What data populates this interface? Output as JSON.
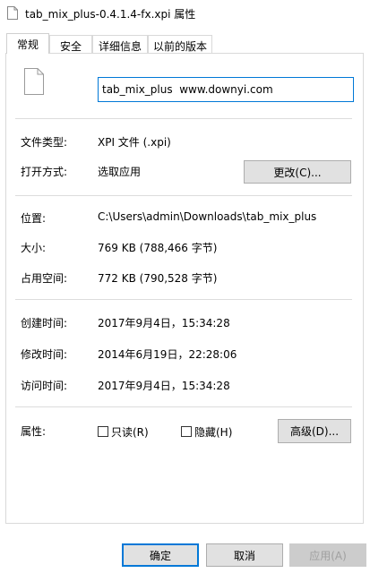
{
  "window": {
    "title": "tab_mix_plus-0.4.1.4-fx.xpi 属性"
  },
  "tabs": [
    {
      "label": "常规"
    },
    {
      "label": "安全"
    },
    {
      "label": "详细信息"
    },
    {
      "label": "以前的版本"
    }
  ],
  "general": {
    "filename": "tab_mix_plus  www.downyi.com",
    "type_label": "文件类型:",
    "type_value": "XPI 文件 (.xpi)",
    "opens_label": "打开方式:",
    "opens_value": "选取应用",
    "change_button": "更改(C)...",
    "location_label": "位置:",
    "location_value": "C:\\Users\\admin\\Downloads\\tab_mix_plus",
    "size_label": "大小:",
    "size_value": "769 KB (788,466 字节)",
    "disk_label": "占用空间:",
    "disk_value": "772 KB (790,528 字节)",
    "created_label": "创建时间:",
    "created_value": "2017年9月4日，15:34:28",
    "modified_label": "修改时间:",
    "modified_value": "2014年6月19日，22:28:06",
    "accessed_label": "访问时间:",
    "accessed_value": "2017年9月4日，15:34:28",
    "attributes_label": "属性:",
    "readonly_label": "只读(R)",
    "readonly_checked": false,
    "hidden_label": "隐藏(H)",
    "hidden_checked": false,
    "advanced_button": "高级(D)..."
  },
  "footer": {
    "ok": "确定",
    "cancel": "取消",
    "apply": "应用(A)"
  },
  "colors": {
    "accent": "#0078d7",
    "separator": "#dcdcdc",
    "button_bg": "#e1e1e1"
  }
}
